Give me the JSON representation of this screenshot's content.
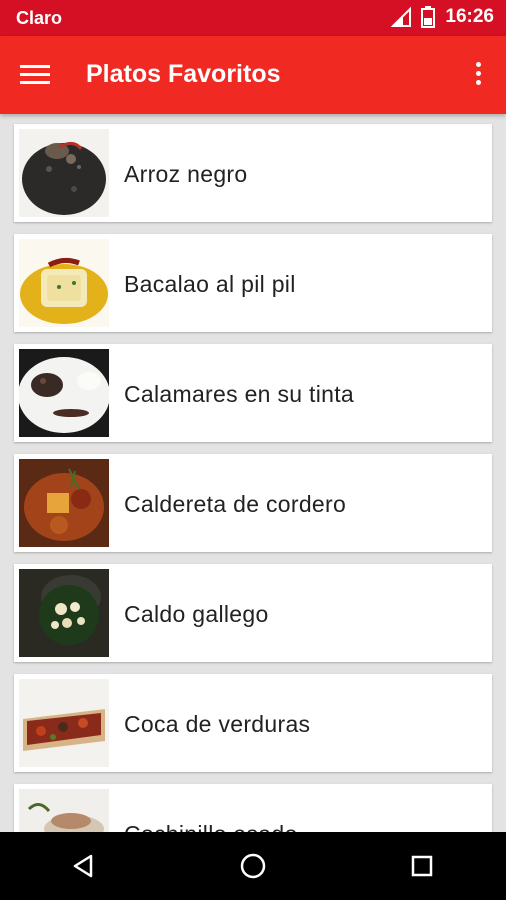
{
  "status_bar": {
    "carrier": "Claro",
    "time": "16:26",
    "icons": [
      "signal-icon",
      "battery-icon"
    ]
  },
  "app_bar": {
    "title": "Platos Favoritos",
    "menu_icon": "hamburger-menu-icon",
    "overflow_icon": "more-vert-icon"
  },
  "dishes": [
    {
      "name": "Arroz negro"
    },
    {
      "name": "Bacalao al pil pil"
    },
    {
      "name": "Calamares en su tinta"
    },
    {
      "name": "Caldereta de cordero"
    },
    {
      "name": "Caldo gallego"
    },
    {
      "name": "Coca de verduras"
    },
    {
      "name": "Cochinillo asado"
    }
  ],
  "nav_bar": {
    "buttons": [
      "back-icon",
      "home-icon",
      "recents-icon"
    ]
  }
}
